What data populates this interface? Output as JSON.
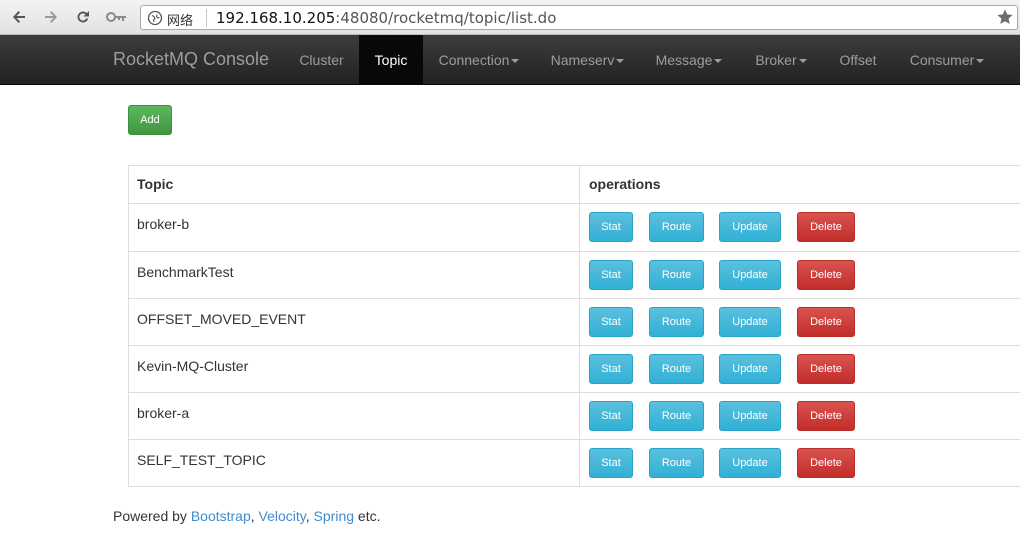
{
  "browser": {
    "site_label": "网络",
    "url_host": "192.168.10.205",
    "url_rest": ":48080/rocketmq/topic/list.do"
  },
  "navbar": {
    "brand": "RocketMQ Console",
    "items": [
      {
        "label": "Cluster",
        "dropdown": false,
        "active": false
      },
      {
        "label": "Topic",
        "dropdown": false,
        "active": true
      },
      {
        "label": "Connection",
        "dropdown": true,
        "active": false
      },
      {
        "label": "Nameserv",
        "dropdown": true,
        "active": false
      },
      {
        "label": "Message",
        "dropdown": true,
        "active": false
      },
      {
        "label": "Broker",
        "dropdown": true,
        "active": false
      },
      {
        "label": "Offset",
        "dropdown": false,
        "active": false
      },
      {
        "label": "Consumer",
        "dropdown": true,
        "active": false
      }
    ]
  },
  "main": {
    "add_label": "Add",
    "table": {
      "headers": [
        "Topic",
        "operations"
      ],
      "actions": [
        "Stat",
        "Route",
        "Update",
        "Delete"
      ],
      "rows": [
        "broker-b",
        "BenchmarkTest",
        "OFFSET_MOVED_EVENT",
        "Kevin-MQ-Cluster",
        "broker-a",
        "SELF_TEST_TOPIC"
      ]
    }
  },
  "footer": {
    "prefix": "Powered by ",
    "links": [
      "Bootstrap",
      "Velocity",
      "Spring"
    ],
    "sep1": ", ",
    "sep2": ", ",
    "suffix": " etc."
  },
  "colors": {
    "navbar_bg": "#222222",
    "active_bg": "#080808",
    "success": "#5cb85c",
    "info": "#5bc0de",
    "danger": "#d9534f",
    "link": "#428bca"
  }
}
